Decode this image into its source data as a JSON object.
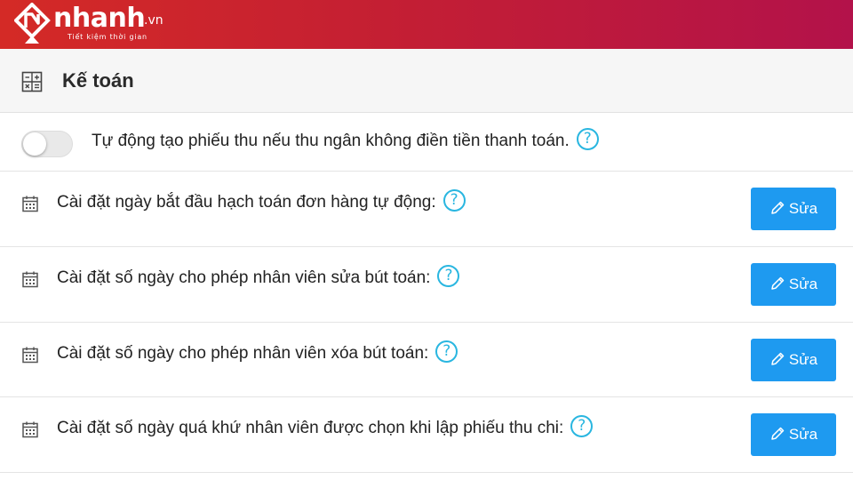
{
  "brand": {
    "name": "nhanh",
    "suffix": ".vn",
    "tagline": "Tiết kiệm thời gian",
    "gradient_start": "#d42a26",
    "gradient_end": "#b3124a"
  },
  "section": {
    "title": "Kế toán",
    "icon": "calculator-icon"
  },
  "toggle_setting": {
    "label": "Tự động tạo phiếu thu nếu thu ngân không điền tiền thanh toán.",
    "enabled": false
  },
  "settings": [
    {
      "label": "Cài đặt ngày bắt đầu hạch toán đơn hàng tự động:",
      "button_label": "Sửa"
    },
    {
      "label": "Cài đặt số ngày cho phép nhân viên sửa bút toán:",
      "button_label": "Sửa"
    },
    {
      "label": "Cài đặt số ngày cho phép nhân viên xóa bút toán:",
      "button_label": "Sửa"
    },
    {
      "label": "Cài đặt số ngày quá khứ nhân viên được chọn khi lập phiếu thu chi:",
      "button_label": "Sửa"
    }
  ],
  "help_glyph": "?",
  "icons": {
    "row": "calendar-icon",
    "help": "help-circle-icon",
    "edit": "pencil-icon"
  },
  "colors": {
    "accent": "#1e9af0",
    "help": "#29b6e0"
  }
}
